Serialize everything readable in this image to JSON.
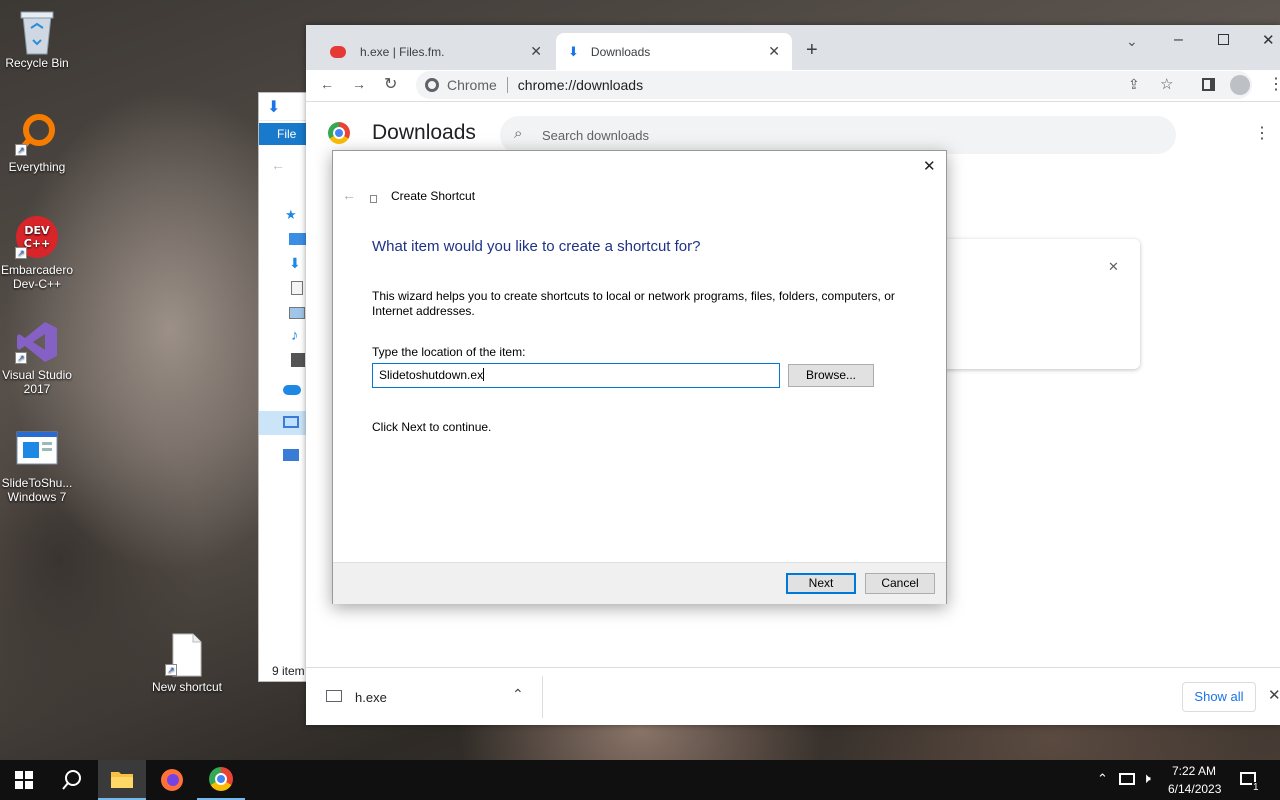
{
  "desktop": {
    "icons": [
      {
        "label": "Recycle Bin"
      },
      {
        "label": "Everything"
      },
      {
        "label": "Embarcadero Dev-C++"
      },
      {
        "label": "Visual Studio 2017"
      },
      {
        "label": "SlideToShu... Windows 7"
      },
      {
        "label": "New shortcut"
      }
    ]
  },
  "explorer": {
    "file_tab": "File",
    "status": "9 item"
  },
  "chrome": {
    "tabs": [
      {
        "label": "h.exe | Files.fm."
      },
      {
        "label": "Downloads"
      }
    ],
    "omnibox": {
      "chip": "Chrome",
      "url": "chrome://downloads"
    },
    "downloads_title": "Downloads",
    "search_placeholder": "Search downloads",
    "shelf": {
      "file": "h.exe",
      "show_all": "Show all"
    }
  },
  "dialog": {
    "title": "Create Shortcut",
    "heading": "What item would you like to create a shortcut for?",
    "description": "This wizard helps you to create shortcuts to local or network programs, files, folders, computers, or Internet addresses.",
    "location_label": "Type the location of the item:",
    "location_value": "Slidetoshutdown.ex",
    "browse": "Browse...",
    "hint": "Click Next to continue.",
    "next": "Next",
    "cancel": "Cancel"
  },
  "taskbar": {
    "time": "7:22 AM",
    "date": "6/14/2023",
    "notification_count": "1"
  },
  "colors": {
    "accent": "#0078d7",
    "dialog_heading": "#1e3287",
    "chrome_link": "#1a73e8"
  }
}
